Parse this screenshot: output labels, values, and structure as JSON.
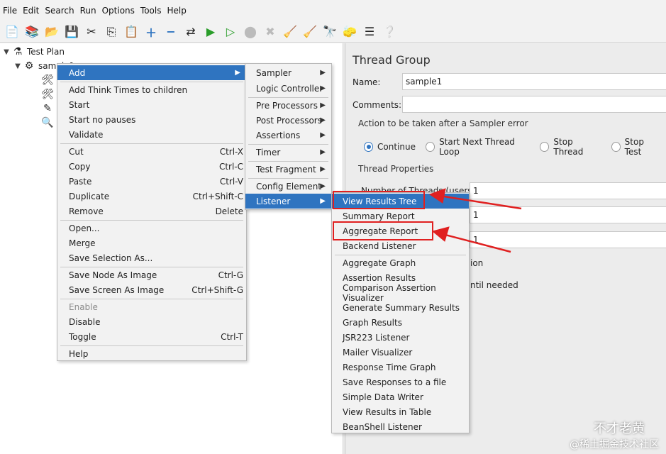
{
  "menubar": [
    "File",
    "Edit",
    "Search",
    "Run",
    "Options",
    "Tools",
    "Help"
  ],
  "tree": {
    "root": "Test Plan",
    "child": "sample1"
  },
  "right_pane": {
    "title": "Thread Group",
    "name_label": "Name:",
    "name_value": "sample1",
    "comments_label": "Comments:",
    "error_section": "Action to be taken after a Sampler error",
    "radios": [
      "Continue",
      "Start Next Thread Loop",
      "Stop Thread",
      "Stop Test"
    ],
    "thread_props": "Thread Properties",
    "threads_label": "Number of Threads (users):",
    "threads_value": "1",
    "rampup_value": "1",
    "loop_value": "1",
    "partial_ion": "ion",
    "partial_needed": "ntil needed"
  },
  "context_menu": {
    "items": [
      {
        "label": "Add",
        "shortcut": "",
        "submenu": true
      },
      {
        "label": "Add Think Times to children",
        "shortcut": ""
      },
      {
        "label": "Start",
        "shortcut": ""
      },
      {
        "label": "Start no pauses",
        "shortcut": ""
      },
      {
        "label": "Validate",
        "shortcut": ""
      },
      {
        "label": "Cut",
        "shortcut": "Ctrl-X"
      },
      {
        "label": "Copy",
        "shortcut": "Ctrl-C"
      },
      {
        "label": "Paste",
        "shortcut": "Ctrl-V"
      },
      {
        "label": "Duplicate",
        "shortcut": "Ctrl+Shift-C"
      },
      {
        "label": "Remove",
        "shortcut": "Delete"
      },
      {
        "label": "Open...",
        "shortcut": ""
      },
      {
        "label": "Merge",
        "shortcut": ""
      },
      {
        "label": "Save Selection As...",
        "shortcut": ""
      },
      {
        "label": "Save Node As Image",
        "shortcut": "Ctrl-G"
      },
      {
        "label": "Save Screen As Image",
        "shortcut": "Ctrl+Shift-G"
      },
      {
        "label": "Enable",
        "shortcut": ""
      },
      {
        "label": "Disable",
        "shortcut": ""
      },
      {
        "label": "Toggle",
        "shortcut": "Ctrl-T"
      },
      {
        "label": "Help",
        "shortcut": ""
      }
    ]
  },
  "add_menu": {
    "items": [
      "Sampler",
      "Logic Controller",
      "Pre Processors",
      "Post Processors",
      "Assertions",
      "Timer",
      "Test Fragment",
      "Config Element",
      "Listener"
    ]
  },
  "listener_menu": {
    "items": [
      "View Results Tree",
      "Summary Report",
      "Aggregate Report",
      "Backend Listener",
      "Aggregate Graph",
      "Assertion Results",
      "Comparison Assertion Visualizer",
      "Generate Summary Results",
      "Graph Results",
      "JSR223 Listener",
      "Mailer Visualizer",
      "Response Time Graph",
      "Save Responses to a file",
      "Simple Data Writer",
      "View Results in Table",
      "BeanShell Listener"
    ]
  },
  "watermark": {
    "name": "不才老黄",
    "site": "@稀土掘金技术社区"
  },
  "colors": {
    "highlight": "#2f74c0",
    "annotation": "#e02020"
  }
}
